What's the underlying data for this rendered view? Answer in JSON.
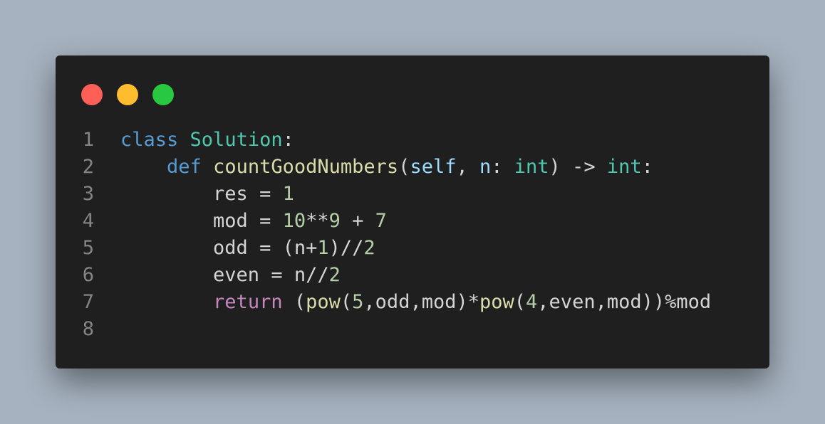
{
  "window": {
    "controls": [
      {
        "name": "close",
        "color": "#ff5f57"
      },
      {
        "name": "minimize",
        "color": "#febc2e"
      },
      {
        "name": "maximize",
        "color": "#28c840"
      }
    ]
  },
  "colors": {
    "keyword": "#569cd6",
    "control_keyword": "#c586c0",
    "class_type": "#4ec9b0",
    "function": "#dcdcaa",
    "parameter": "#9cdcfe",
    "number": "#b5cea8",
    "plain": "#d4d4d4",
    "line_number": "#858585"
  },
  "code": {
    "lines": [
      {
        "number": "1",
        "tokens": [
          {
            "text": "class",
            "kind": "keyword"
          },
          {
            "text": " ",
            "kind": "plain"
          },
          {
            "text": "Solution",
            "kind": "class_type"
          },
          {
            "text": ":",
            "kind": "plain"
          }
        ]
      },
      {
        "number": "2",
        "tokens": [
          {
            "text": "    ",
            "kind": "plain"
          },
          {
            "text": "def",
            "kind": "keyword"
          },
          {
            "text": " ",
            "kind": "plain"
          },
          {
            "text": "countGoodNumbers",
            "kind": "function"
          },
          {
            "text": "(",
            "kind": "plain"
          },
          {
            "text": "self",
            "kind": "parameter"
          },
          {
            "text": ", ",
            "kind": "plain"
          },
          {
            "text": "n",
            "kind": "parameter"
          },
          {
            "text": ": ",
            "kind": "plain"
          },
          {
            "text": "int",
            "kind": "class_type"
          },
          {
            "text": ") -> ",
            "kind": "plain"
          },
          {
            "text": "int",
            "kind": "class_type"
          },
          {
            "text": ":",
            "kind": "plain"
          }
        ]
      },
      {
        "number": "3",
        "tokens": [
          {
            "text": "        res = ",
            "kind": "plain"
          },
          {
            "text": "1",
            "kind": "number"
          }
        ]
      },
      {
        "number": "4",
        "tokens": [
          {
            "text": "        mod = ",
            "kind": "plain"
          },
          {
            "text": "10",
            "kind": "number"
          },
          {
            "text": "**",
            "kind": "plain"
          },
          {
            "text": "9",
            "kind": "number"
          },
          {
            "text": " + ",
            "kind": "plain"
          },
          {
            "text": "7",
            "kind": "number"
          }
        ]
      },
      {
        "number": "5",
        "tokens": [
          {
            "text": "        odd = (n+",
            "kind": "plain"
          },
          {
            "text": "1",
            "kind": "number"
          },
          {
            "text": ")//",
            "kind": "plain"
          },
          {
            "text": "2",
            "kind": "number"
          }
        ]
      },
      {
        "number": "6",
        "tokens": [
          {
            "text": "        even = n//",
            "kind": "plain"
          },
          {
            "text": "2",
            "kind": "number"
          }
        ]
      },
      {
        "number": "7",
        "tokens": [
          {
            "text": "        ",
            "kind": "plain"
          },
          {
            "text": "return",
            "kind": "control_keyword"
          },
          {
            "text": " (",
            "kind": "plain"
          },
          {
            "text": "pow",
            "kind": "function"
          },
          {
            "text": "(",
            "kind": "plain"
          },
          {
            "text": "5",
            "kind": "number"
          },
          {
            "text": ",odd,mod)*",
            "kind": "plain"
          },
          {
            "text": "pow",
            "kind": "function"
          },
          {
            "text": "(",
            "kind": "plain"
          },
          {
            "text": "4",
            "kind": "number"
          },
          {
            "text": ",even,mod))%mod",
            "kind": "plain"
          }
        ]
      },
      {
        "number": "8",
        "tokens": []
      }
    ]
  }
}
